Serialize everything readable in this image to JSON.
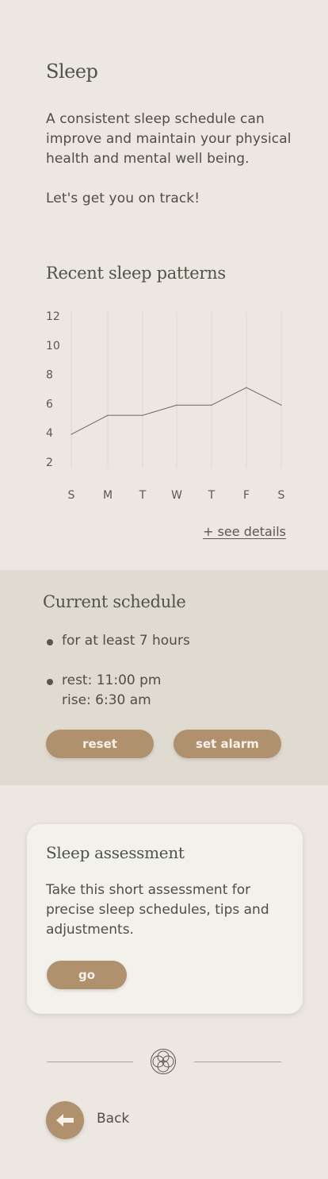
{
  "header": {
    "title": "Sleep",
    "icon": "moon-icon"
  },
  "intro": {
    "paragraph_1": "A consistent sleep schedule can improve and maintain your physical health and mental well being.",
    "paragraph_2": "Let's get you on track!"
  },
  "patterns": {
    "title": "Recent sleep patterns",
    "see_details": "+ see details"
  },
  "chart_data": {
    "type": "line",
    "title": "",
    "xlabel": "",
    "ylabel": "",
    "categories": [
      "S",
      "M",
      "T",
      "W",
      "T",
      "F",
      "S"
    ],
    "y_ticks": [
      "12",
      "10",
      "8",
      "6",
      "4",
      "2"
    ],
    "ylim": [
      1,
      12
    ],
    "grid": "vertical",
    "series": [
      {
        "values": [
          3.9,
          5.2,
          5.2,
          5.9,
          5.9,
          7.1,
          5.9
        ]
      }
    ],
    "colors": {
      "line": "#6a6860",
      "grid": "#dcd8d0"
    }
  },
  "schedule": {
    "title": "Current schedule",
    "duration": "for at least 7 hours",
    "rest": "rest: 11:00 pm",
    "rise": "rise: 6:30 am",
    "reset_label": "reset",
    "alarm_label": "set alarm"
  },
  "assessment": {
    "title": "Sleep assessment",
    "description": "Take this short assessment for precise sleep schedules, tips and adjustments.",
    "go_label": "go"
  },
  "footer": {
    "back_label": "Back",
    "divider_icon": "flower-icon",
    "back_icon": "arrow-left-icon"
  },
  "colors": {
    "background": "#ece8e1",
    "schedule_background": "#dfdbd1",
    "accent": "#b0916d",
    "card": "#f3f1ec"
  }
}
